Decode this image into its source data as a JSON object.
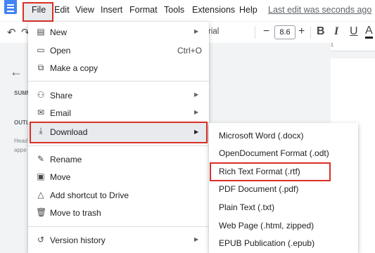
{
  "menubar": {
    "items": [
      "File",
      "Edit",
      "View",
      "Insert",
      "Format",
      "Tools",
      "Extensions",
      "Help"
    ],
    "last_edit": "Last edit was seconds ago"
  },
  "toolbar": {
    "font_name": "rial",
    "font_size": "8.6",
    "minus": "−",
    "plus": "+",
    "bold": "B",
    "italic": "I",
    "underline": "U",
    "text_color": "A"
  },
  "ruler": {
    "mark": "1"
  },
  "sidebar": {
    "summary": "SUMM",
    "outline": "OUTL",
    "hint_line1": "Head",
    "hint_line2": "appe"
  },
  "file_menu": {
    "new": "New",
    "open": "Open",
    "open_shortcut": "Ctrl+O",
    "make_copy": "Make a copy",
    "share": "Share",
    "email": "Email",
    "download": "Download",
    "rename": "Rename",
    "move": "Move",
    "add_shortcut": "Add shortcut to Drive",
    "move_trash": "Move to trash",
    "version_history": "Version history"
  },
  "download_menu": {
    "items": [
      "Microsoft Word (.docx)",
      "OpenDocument Format (.odt)",
      "Rich Text Format (.rtf)",
      "PDF Document (.pdf)",
      "Plain Text (.txt)",
      "Web Page (.html, zipped)",
      "EPUB Publication (.epub)"
    ]
  },
  "colors": {
    "highlight_border": "#d93025",
    "active_row": "#e8eaed",
    "docs_blue": "#4285f4"
  }
}
